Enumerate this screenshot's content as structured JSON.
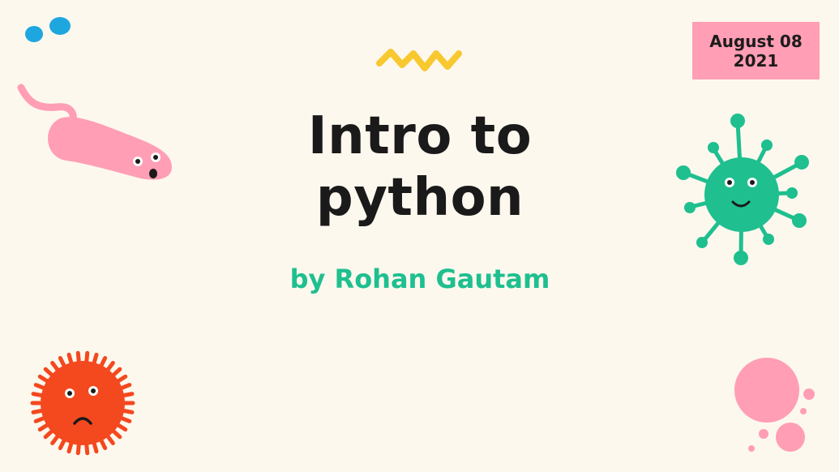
{
  "slide": {
    "date_line1": "August 08",
    "date_line2": "2021",
    "title_line1": "Intro to",
    "title_line2": "python",
    "subtitle": "by Rohan Gautam"
  },
  "decorations": {
    "icons": [
      "dots-icon",
      "squiggle-icon",
      "pink-worm-icon",
      "green-virus-icon",
      "red-germ-icon",
      "pink-bubbles-icon"
    ]
  },
  "colors": {
    "background": "#fdf8ee",
    "badge": "#ff9eb5",
    "accent_green": "#1fbf8f",
    "title": "#1a1a1a"
  }
}
